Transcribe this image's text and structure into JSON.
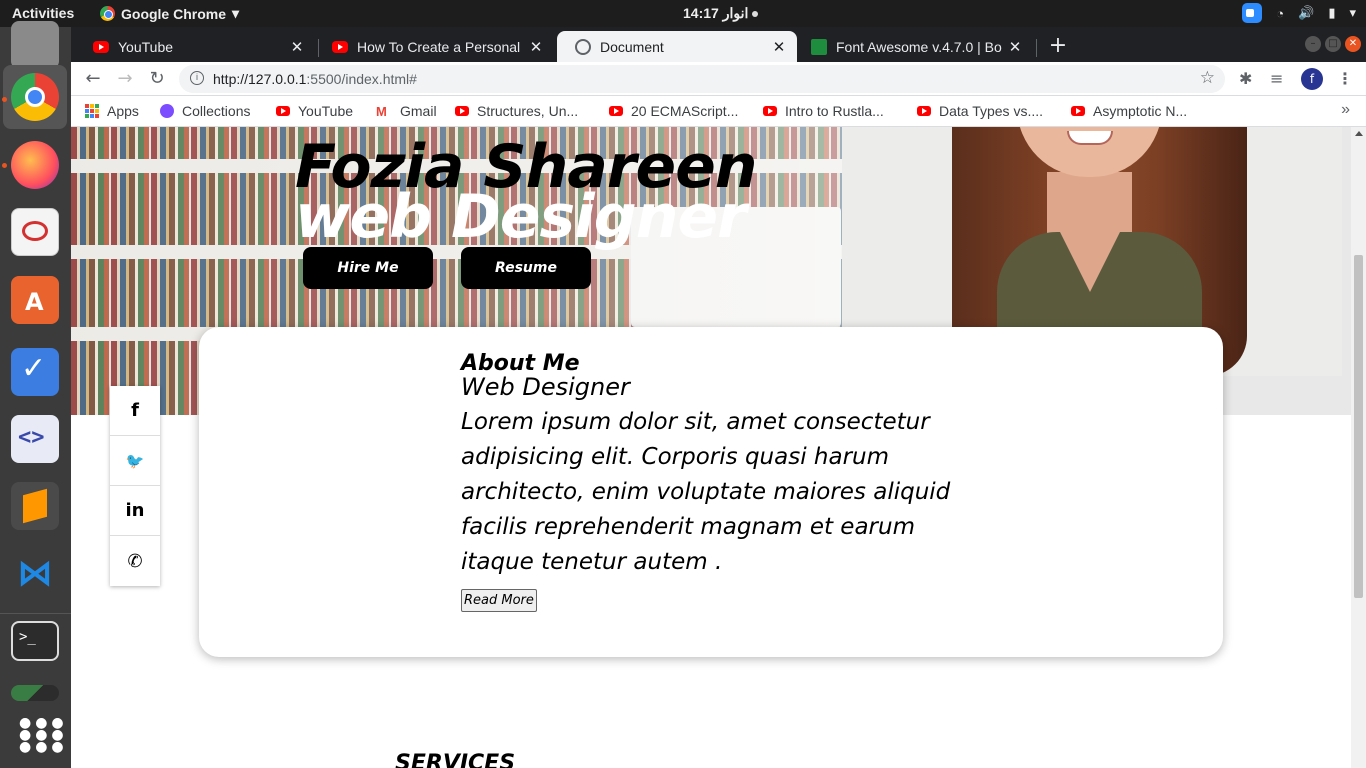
{
  "topbar": {
    "activities": "Activities",
    "app_name": "Google Chrome",
    "clock": "انوار 14:17",
    "icons": [
      "zoom-icon",
      "wifi-icon",
      "volume-icon",
      "battery-icon",
      "chevron-down-icon"
    ]
  },
  "dock": {
    "apps": [
      "files",
      "google-chrome",
      "firefox",
      "ebook-reader",
      "ubuntu-software",
      "tasks",
      "code-editor",
      "sublime-text",
      "vs-code",
      "terminal",
      "system-monitor",
      "show-applications"
    ]
  },
  "tabs": [
    {
      "title": "YouTube",
      "icon": "youtube-icon",
      "active": false
    },
    {
      "title": "How To Create a Personal",
      "icon": "youtube-icon",
      "active": false
    },
    {
      "title": "Document",
      "icon": "globe-icon",
      "active": true
    },
    {
      "title": "Font Awesome v.4.7.0 | Bo",
      "icon": "font-awesome-icon",
      "active": false
    }
  ],
  "toolbar": {
    "url_host": "http://127.0.0.1",
    "url_rest": ":5500/index.html#",
    "profile_initial": "f"
  },
  "bookmarks": [
    {
      "label": "Apps",
      "icon": "apps-grid-icon"
    },
    {
      "label": "Collections",
      "icon": "collections-icon"
    },
    {
      "label": "YouTube",
      "icon": "youtube-icon"
    },
    {
      "label": "Gmail",
      "icon": "gmail-icon"
    },
    {
      "label": "Structures, Un...",
      "icon": "youtube-icon"
    },
    {
      "label": "20 ECMAScript...",
      "icon": "youtube-icon"
    },
    {
      "label": "Intro to Rustla...",
      "icon": "youtube-icon"
    },
    {
      "label": "Data Types vs....",
      "icon": "youtube-icon"
    },
    {
      "label": "Asymptotic N...",
      "icon": "youtube-icon"
    }
  ],
  "hero": {
    "name": "Fozia Shareen",
    "role": "web Designer",
    "hire_label": "Hire Me",
    "resume_label": "Resume"
  },
  "about": {
    "heading": "About Me",
    "subtitle": "Web Designer",
    "body": "Lorem ipsum dolor sit, amet consectetur adipisicing elit. Corporis quasi harum architecto, enim voluptate maiores aliquid facilis reprehenderit magnam et earum itaque tenetur autem .",
    "read_more": "Read More"
  },
  "social": {
    "facebook": "f",
    "twitter": "🐦",
    "linkedin": "in",
    "whatsapp": "✆"
  },
  "services": {
    "heading": "SERVICES"
  },
  "colors": {
    "button_bg": "#000000",
    "tabstrip_bg": "#202124",
    "dock_bg": "#3b3b3b"
  }
}
